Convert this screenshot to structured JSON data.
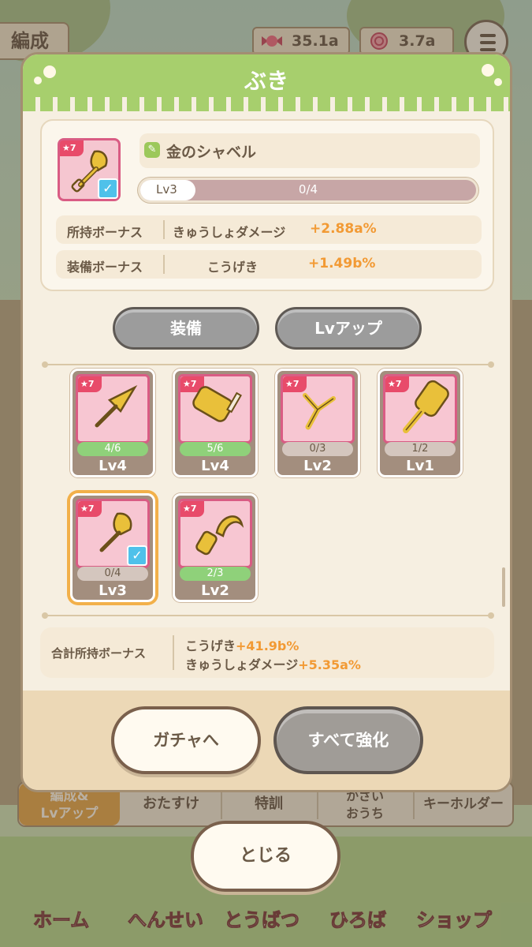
{
  "hud": {
    "title": "編成",
    "resources": [
      {
        "icon": "candy-icon",
        "value": "35.1a"
      },
      {
        "icon": "swirl-candy-icon",
        "value": "3.7a"
      }
    ]
  },
  "tabs": [
    "編成&\nLvアップ",
    "おたすけ",
    "特訓",
    "かざい\nおうち",
    "キーホルダー"
  ],
  "nav": [
    "ホーム",
    "へんせい",
    "とうばつ",
    "ひろば",
    "ショップ"
  ],
  "modal": {
    "title": "ぶき",
    "selected": {
      "rarity": "7",
      "name": "金のシャベル",
      "level": "Lv3",
      "progress_text": "0/4",
      "progress": 0.1,
      "own_bonus_label": "所持ボーナス",
      "own_bonus_stat": "きゅうしょダメージ",
      "own_bonus_value": "+2.88a%",
      "equip_bonus_label": "装備ボーナス",
      "equip_bonus_stat": "こうげき",
      "equip_bonus_value": "+1.49b%"
    },
    "buttons": {
      "equip": "装備",
      "lvup": "Lvアップ"
    },
    "weapons": [
      {
        "rarity": "7",
        "count": "4/6",
        "level": "Lv4",
        "fill": 0.67,
        "icon": "arrowhead-icon"
      },
      {
        "rarity": "7",
        "count": "5/6",
        "level": "Lv4",
        "fill": 0.83,
        "icon": "hammer-icon"
      },
      {
        "rarity": "7",
        "count": "0/3",
        "level": "Lv2",
        "fill": 0,
        "icon": "slingshot-icon"
      },
      {
        "rarity": "7",
        "count": "1/2",
        "level": "Lv1",
        "fill": 0.5,
        "icon": "spatula-icon"
      },
      {
        "rarity": "7",
        "count": "0/4",
        "level": "Lv3",
        "fill": 0,
        "icon": "shovel-icon"
      },
      {
        "rarity": "7",
        "count": "2/3",
        "level": "Lv2",
        "fill": 0.67,
        "icon": "sickle-icon"
      }
    ],
    "total": {
      "label": "合計所持ボーナス",
      "line1_stat": "こうげき",
      "line1_value": "+41.9b%",
      "line2_stat": "きゅうしょダメージ",
      "line2_value": "+5.35a%"
    },
    "footer": {
      "gacha": "ガチャへ",
      "upgrade_all": "すべて強化"
    }
  },
  "close_label": "とじる",
  "colors": {
    "accent_orange": "#f29a34",
    "header_green": "#a7cf6d",
    "rarity_pink": "#d95c84"
  }
}
